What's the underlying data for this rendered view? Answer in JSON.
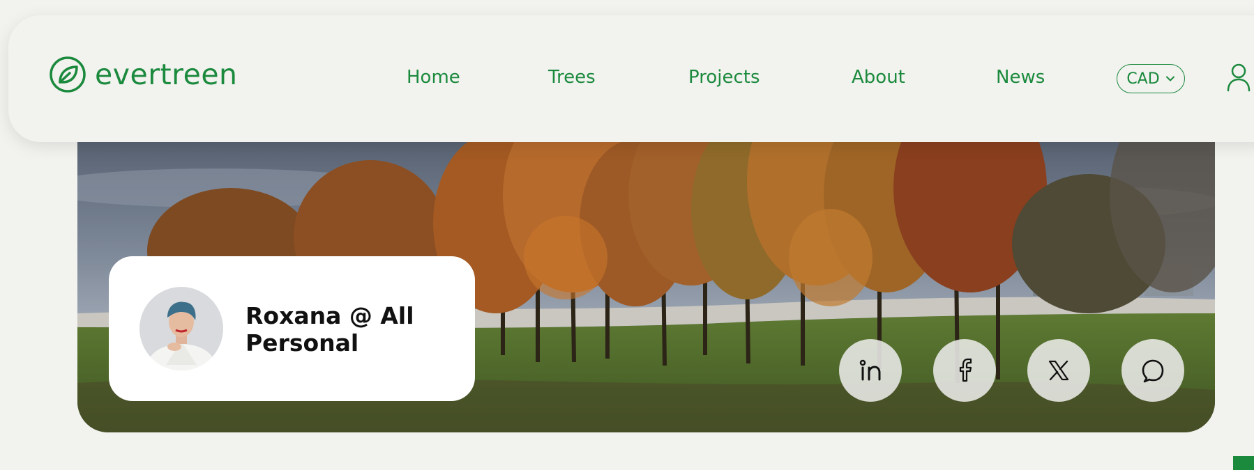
{
  "brand": {
    "name": "evertreen",
    "logo_icon": "leaf-circle-icon",
    "color": "#1b8a3d"
  },
  "nav": {
    "items": [
      {
        "label": "Home"
      },
      {
        "label": "Trees"
      },
      {
        "label": "Projects"
      },
      {
        "label": "About"
      },
      {
        "label": "News"
      }
    ],
    "currency": {
      "value": "CAD",
      "icon": "chevron-down-icon"
    },
    "user_icon": "user-icon"
  },
  "profile": {
    "name": "Roxana @ All Personal",
    "avatar_icon": "avatar"
  },
  "social": [
    {
      "icon": "linkedin-icon"
    },
    {
      "icon": "facebook-icon"
    },
    {
      "icon": "x-icon"
    },
    {
      "icon": "chat-icon"
    }
  ],
  "colors": {
    "accent": "#1b8a3d",
    "background": "#f2f2ef",
    "card": "#ffffff"
  }
}
